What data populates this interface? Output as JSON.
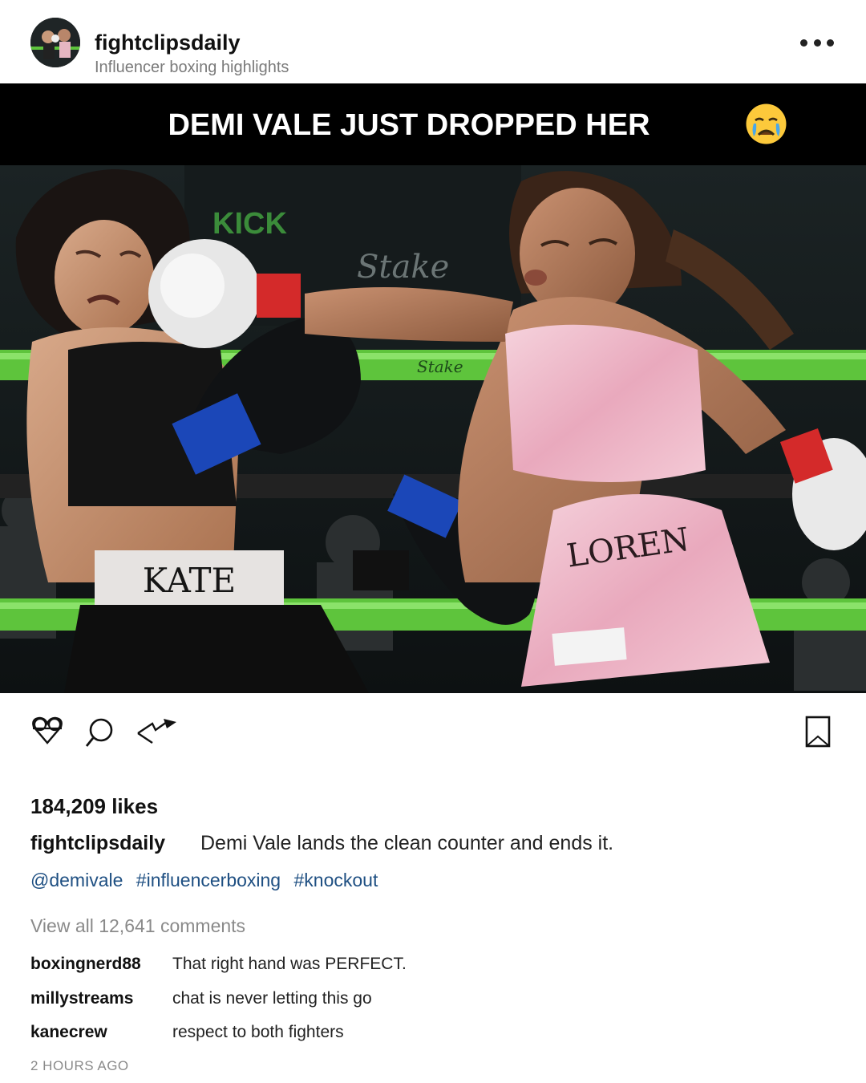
{
  "post": {
    "username": "fightclipsdaily",
    "subtitle": "Influencer boxing highlights",
    "banner_text": "DEMI VALE JUST DROPPED HER",
    "banner_emoji": "crying-face-icon",
    "photo": {
      "left_fighter_trunks": "KATE",
      "right_fighter_trunks": "LOREN",
      "sponsor_text": "Stake",
      "ring_rope_color": "#5ec43c"
    },
    "likes": "184,209 likes",
    "caption_user": "fightclipsdaily",
    "caption_text": "Demi Vale lands the clean counter and ends it.",
    "tags": [
      "@demivale",
      "#influencerboxing",
      "#knockout"
    ],
    "view_all": "View all 12,641 comments",
    "comments": [
      {
        "user": "boxingnerd88",
        "text": "That right hand was PERFECT."
      },
      {
        "user": "millystreams",
        "text": "chat is never letting this go"
      },
      {
        "user": "kanecrew",
        "text": "respect to both fighters"
      }
    ],
    "timestamp": "2 HOURS AGO"
  },
  "icons": [
    "heart-icon",
    "comment-icon",
    "share-icon",
    "bookmark-icon",
    "more-icon"
  ],
  "colors": {
    "link": "#1e4f82",
    "banner_bg": "#000000",
    "muted": "#8a8a8a"
  }
}
